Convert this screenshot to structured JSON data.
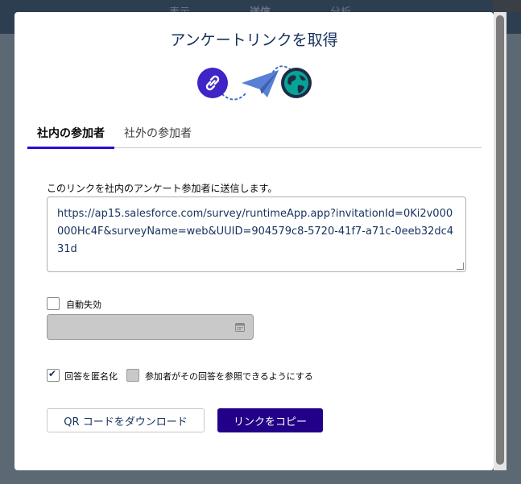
{
  "background": {
    "tabs": [
      "表示",
      "送信",
      "分析"
    ]
  },
  "modal": {
    "title": "アンケートリンクを取得",
    "tabs": [
      {
        "label": "社内の参加者",
        "active": true
      },
      {
        "label": "社外の参加者",
        "active": false
      }
    ],
    "send_label": "このリンクを社内のアンケート参加者に送信します。",
    "url": "https://ap15.salesforce.com/survey/runtimeApp.app?invitationId=0Ki2v000000Hc4F&surveyName=web&UUID=904579c8-5720-41f7-a71c-0eeb32dc431d",
    "auto_expire": {
      "label": "自動失効",
      "checked": false
    },
    "anonymize": {
      "label": "回答を匿名化",
      "checked": true
    },
    "share_responses": {
      "label": "参加者がその回答を参照できるようにする",
      "checked": false,
      "disabled": true
    },
    "buttons": {
      "qr": "QR コードをダウンロード",
      "copy": "リンクをコピー"
    }
  },
  "icons": {
    "link": "link-icon",
    "send": "paper-plane-icon",
    "globe": "globe-icon",
    "calendar": "calendar-icon"
  },
  "colors": {
    "brand": "#220087",
    "tab_underline": "#2e0bd1",
    "icon_blue": "#3f24c7",
    "globe_teal": "#04a597",
    "plane": "#5a7fd6"
  }
}
